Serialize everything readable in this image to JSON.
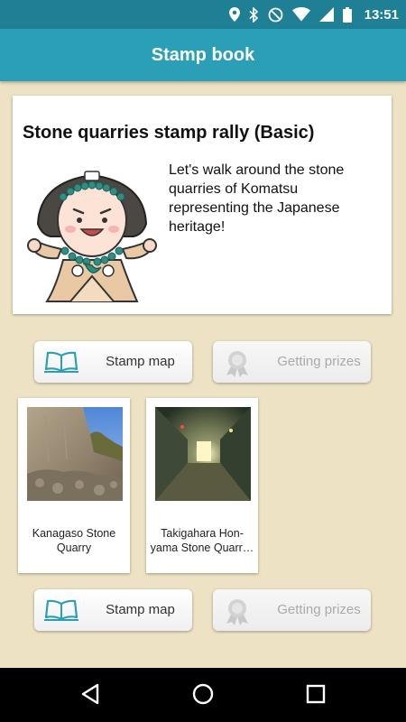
{
  "status_bar": {
    "time": "13:51",
    "icons": [
      "location-icon",
      "bluetooth-icon",
      "do-not-disturb-icon",
      "wifi-icon",
      "signal-icon",
      "battery-icon"
    ]
  },
  "app_bar": {
    "title": "Stamp book"
  },
  "rally_card": {
    "title": "Stone quarries stamp rally (Basic)",
    "description": "Let's walk around the stone quarries of Komatsu representing the Japanese heritage!",
    "mascot": "mascot-character"
  },
  "buttons": {
    "stamp_map_label": "Stamp map",
    "getting_prizes_label": "Getting prizes"
  },
  "quarries": [
    {
      "name": "Kanagaso Stone Quarry"
    },
    {
      "name": "Takigahara Hon-yama Stone Quarr…"
    }
  ],
  "nav_bar": {
    "back": "back-icon",
    "home": "home-icon",
    "recents": "recents-icon"
  },
  "colors": {
    "status_bar": "#1e7f95",
    "app_bar": "#2a9fb6",
    "background": "#ede3c4",
    "accent_icon": "#2a9fb6"
  }
}
